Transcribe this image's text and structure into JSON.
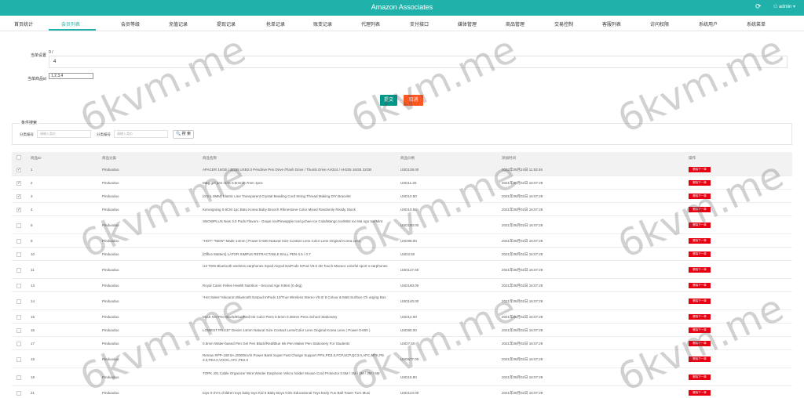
{
  "header": {
    "title": "Amazon Associates",
    "refresh_icon": "refresh-icon",
    "user_label": "⚇ admin ▾"
  },
  "nav": {
    "tabs": [
      "首页统计",
      "会员列表",
      "会员等级",
      "充值记录",
      "提现记录",
      "抢单记录",
      "账变记录",
      "代理列表",
      "支付接口",
      "媒体管理",
      "商品管理",
      "交易控制",
      "客服列表",
      "访问权限",
      "系统用户",
      "系统菜单"
    ],
    "active_index": 1
  },
  "form": {
    "field1_label": "当单设置",
    "field1_hint": "0 / ",
    "field1_value": "4",
    "field2_label": "当单商品id",
    "field2_value": "1,2,3,4",
    "submit_label": "提交",
    "cancel_label": "取消"
  },
  "search": {
    "title": "条件搜索",
    "label1": "分类编号",
    "placeholder1": "请输入类价",
    "label2": "分类编号",
    "placeholder2": "请输入类价",
    "button_label": "🔍 搜 索"
  },
  "table": {
    "headers": [
      "商品ID",
      "商品分类",
      "商品名称",
      "商品价格",
      "添加时间",
      "操作"
    ],
    "action_label": "删除下一单",
    "rows": [
      {
        "id": "1",
        "cat": "Pinduoduo",
        "name": "APACER 16GB / 32GB USB2.0 Pendrive Pen Drive /Flash Drive / Thumb Drive AH324 / AH335 16GB 32GB",
        "price": "USD139.00",
        "time": "2022年05月24日 11:52:46",
        "checked": true
      },
      {
        "id": "2",
        "cat": "Pinduoduo",
        "name": "M&g gel pen r2/r5 0.5mm/0.7mm 1pcs",
        "price": "USD11.20",
        "time": "2021年08月02日 16:07:29",
        "checked": true
      },
      {
        "id": "3",
        "cat": "Pinduoduo",
        "name": "(0.5-1.0MM) Elastic Line Transparent Crystal Beading Cord String Thread Making DIY Bracelet",
        "price": "USD10.50",
        "time": "2021年08月02日 16:07:29",
        "checked": true
      },
      {
        "id": "4",
        "cat": "Pinduoduo",
        "name": "Kerongrang 0.8CM 1pc Batu Korea Baby Brooch Rhinestone Color Mixed Randomly Ready Stock",
        "price": "USD10.50",
        "time": "2021年08月02日 16:07:29",
        "checked": true
      },
      {
        "id": "6",
        "cat": "Pinduoduo",
        "name": "SNOWPLUS New 3.0 Pods Flavors - Grape Ice/Pineapple Ice/Lychee Ice Cola/Mango Ice/Mint Ice Ma ngo Ice/Mint",
        "price": "USD150.00",
        "time": "2021年08月02日 16:07:29",
        "checked": false
      },
      {
        "id": "8",
        "cat": "Pinduoduo",
        "name": "*HOT* *NEW* Made 14mm | Power 0-500 Natural Size Contact Lens Color Lens Original Korea Lens",
        "price": "USD98.00",
        "time": "2021年08月02日 16:07:29",
        "checked": false
      },
      {
        "id": "10",
        "cat": "Pinduoduo",
        "name": "[Office Matters] LATOR SIMPLE RETRACTABLE BALL PEN 0.5 / 0.7",
        "price": "USD3.50",
        "time": "2021年08月02日 16:07:29",
        "checked": false
      },
      {
        "id": "11",
        "cat": "Pinduoduo",
        "name": "i12 TWS Bluetooth wireless earphones Inpod Airpod EarPods InPod V5.0 3D Touch Macaro colorful sport s earphones",
        "price": "USD127.60",
        "time": "2021年08月02日 16:07:29",
        "checked": false
      },
      {
        "id": "13",
        "cat": "Pinduoduo",
        "name": "Royal Canin Feline Health Nutrition - Second Age Kitten (0.4kg)",
        "price": "USD180.00",
        "time": "2021年08月02日 16:07:29",
        "checked": false
      },
      {
        "id": "14",
        "cat": "Pinduoduo",
        "name": "*Hot Sales* Macaron Bluetooth Earpod InPods 12/True Wireless Stereo V5.0/ 8 Colour & Matt Surface Ch arging Box",
        "price": "USD140.00",
        "time": "2021年08月02日 16:07:29",
        "checked": false
      },
      {
        "id": "15",
        "cat": "Pinduoduo",
        "name": "MUJI Gel Pen Black/Blue/Red Ink Color Pens 0.5mm 0.38mm Pens School Stationary",
        "price": "USD14.00",
        "time": "2021年08月02日 16:07:29",
        "checked": false
      },
      {
        "id": "16",
        "cat": "Pinduoduo",
        "name": "LOWEST PRICE* Desire 14mm Natural Size Contact Lens/Color Lens Original Korea Lens ( Power 0-600 )",
        "price": "USD90.00",
        "time": "2021年08月02日 16:07:29",
        "checked": false
      },
      {
        "id": "17",
        "cat": "Pinduoduo",
        "name": "0.5mm Water-based Pen Gel Pen Black/Red/Blue Ink Pen Maker Pen Stationery For Students",
        "price": "USD7.50",
        "time": "2021年08月02日 16:07:29",
        "checked": false
      },
      {
        "id": "18",
        "cat": "Pinduoduo",
        "name": "Remax RPP-108 5A 20000mAh Power Bank Super Fast Charge Support PPS,PD3.0,FCP,SCP,QC3.0,AFC,MTK,PE 3.0,PE2.0,VOOC,AFC,PE2.0",
        "price": "USD677.00",
        "time": "2021年08月02日 16:07:29",
        "checked": false
      },
      {
        "id": "19",
        "cat": "Pinduoduo",
        "name": "TOPK J01 Cable Organizer Wire Winder Earphone Velcro holder Mouse Cord Protector 0.5M / 1M / 2M / 3M / 5M",
        "price": "USD15.80",
        "time": "2021年08月02日 16:07:29",
        "checked": false
      },
      {
        "id": "21",
        "cat": "Pinduoduo",
        "name": "toys 0-3Yrs children toys baby toys Kid 5 Baby Boys Girls Educational Toys Early Fun Ball Tower Turn Musi",
        "price": "USD124.00",
        "time": "2021年08月02日 16:07:29",
        "checked": false
      }
    ]
  },
  "watermark": "6kvm.me"
}
